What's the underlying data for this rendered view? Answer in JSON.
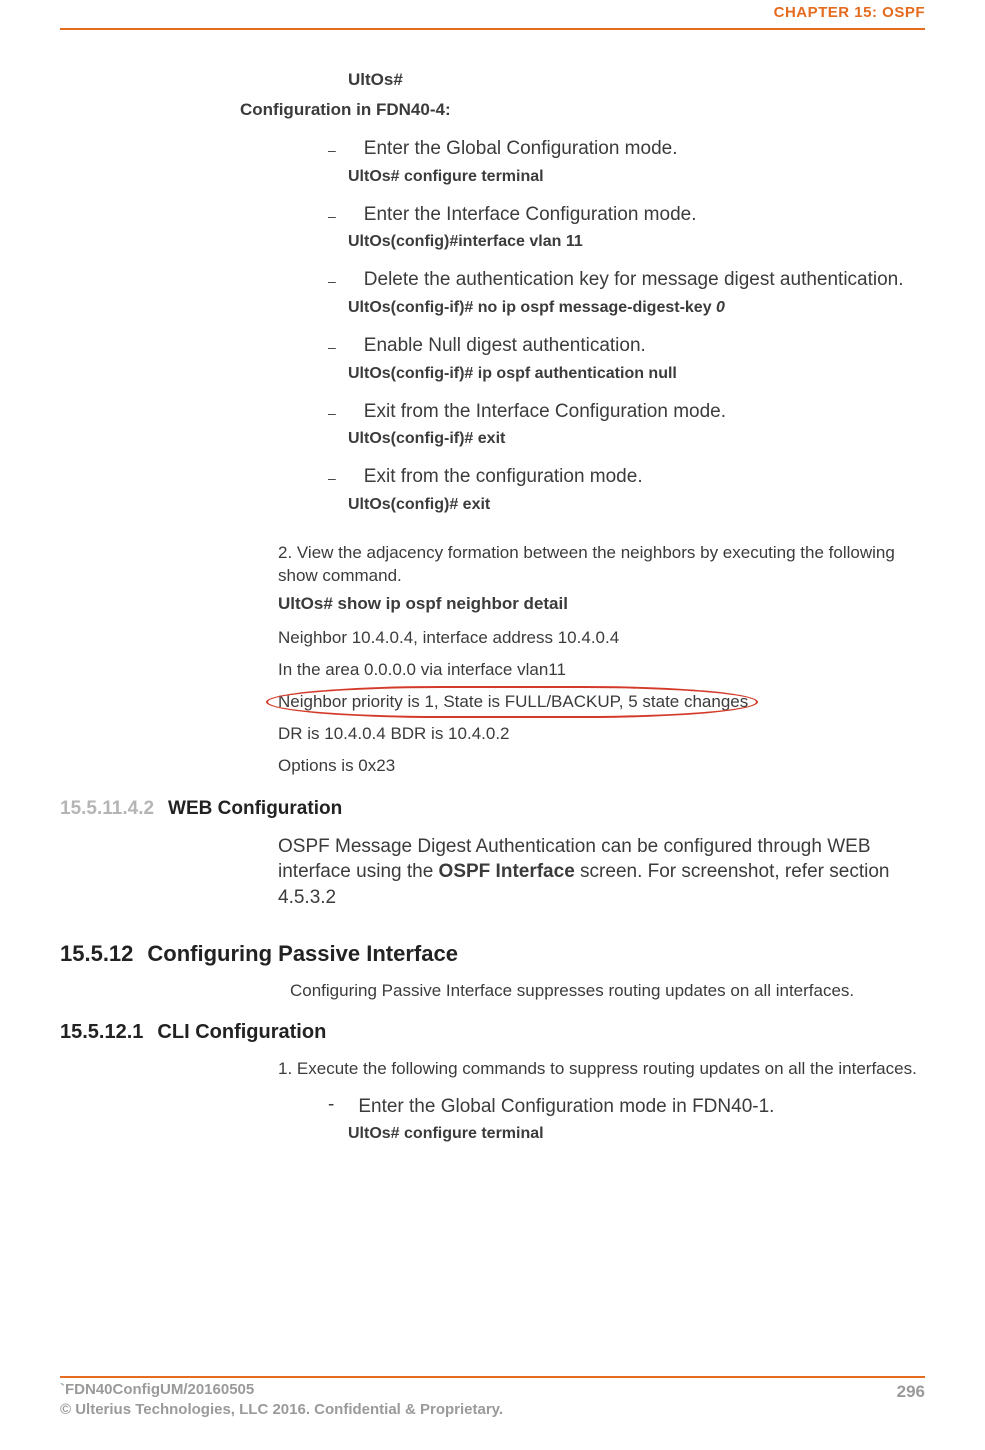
{
  "header": {
    "chapter": "CHAPTER 15: OSPF"
  },
  "intro": {
    "prompt": "UltOs#",
    "config_label": "Configuration in FDN40-4:"
  },
  "steps": [
    {
      "text": "Enter the Global Configuration mode.",
      "cmd": "UltOs# configure terminal"
    },
    {
      "text": "Enter the Interface Configuration mode.",
      "cmd": "UltOs(config)#interface vlan 11"
    },
    {
      "text": "Delete the authentication key for message digest authentication.",
      "cmd": "UltOs(config-if)# no ip ospf message-digest-key ",
      "cmd_italic": "0"
    },
    {
      "text": "Enable Null digest authentication.",
      "cmd": "UltOs(config-if)# ip ospf authentication null"
    },
    {
      "text": "Exit from the Interface Configuration mode.",
      "cmd": "UltOs(config-if)# exit"
    },
    {
      "text": "Exit from the configuration mode.",
      "cmd": "UltOs(config)# exit"
    }
  ],
  "view": {
    "intro": "2. View the adjacency formation between the neighbors by executing the following show command.",
    "cmd": "UltOs# show ip ospf neighbor detail",
    "output": [
      "Neighbor 10.4.0.4, interface address 10.4.0.4",
      "In the area 0.0.0.0 via interface vlan11",
      "Neighbor priority is 1, State is FULL/BACKUP, 5 state changes",
      "DR is 10.4.0.4 BDR is 10.4.0.2",
      "Options is 0x23"
    ],
    "highlighted_index": 2
  },
  "web": {
    "num": "15.5.11.4.2",
    "title": "WEB Configuration",
    "para_prefix": "O",
    "para_rest": "SPF Message Digest Authentication can be configured through WEB interface using the ",
    "para_bold": "OSPF Interface",
    "para_tail": " screen. For screenshot, refer section 4.5.3.2"
  },
  "passive": {
    "num": "15.5.12",
    "title": "Configuring Passive Interface",
    "desc": "Configuring Passive Interface suppresses routing updates on all interfaces."
  },
  "cli": {
    "num": "15.5.12.1",
    "title": "CLI Configuration",
    "intro": "1. Execute the following commands to suppress routing updates on all the interfaces.",
    "step_text": "Enter the Global Configuration mode in FDN40-1.",
    "step_cmd": "UltOs# configure terminal"
  },
  "footer": {
    "doc_id": "`FDN40ConfigUM/20160505",
    "copyright": "© Ulterius Technologies, LLC 2016. Confidential & Proprietary.",
    "page": "296"
  }
}
